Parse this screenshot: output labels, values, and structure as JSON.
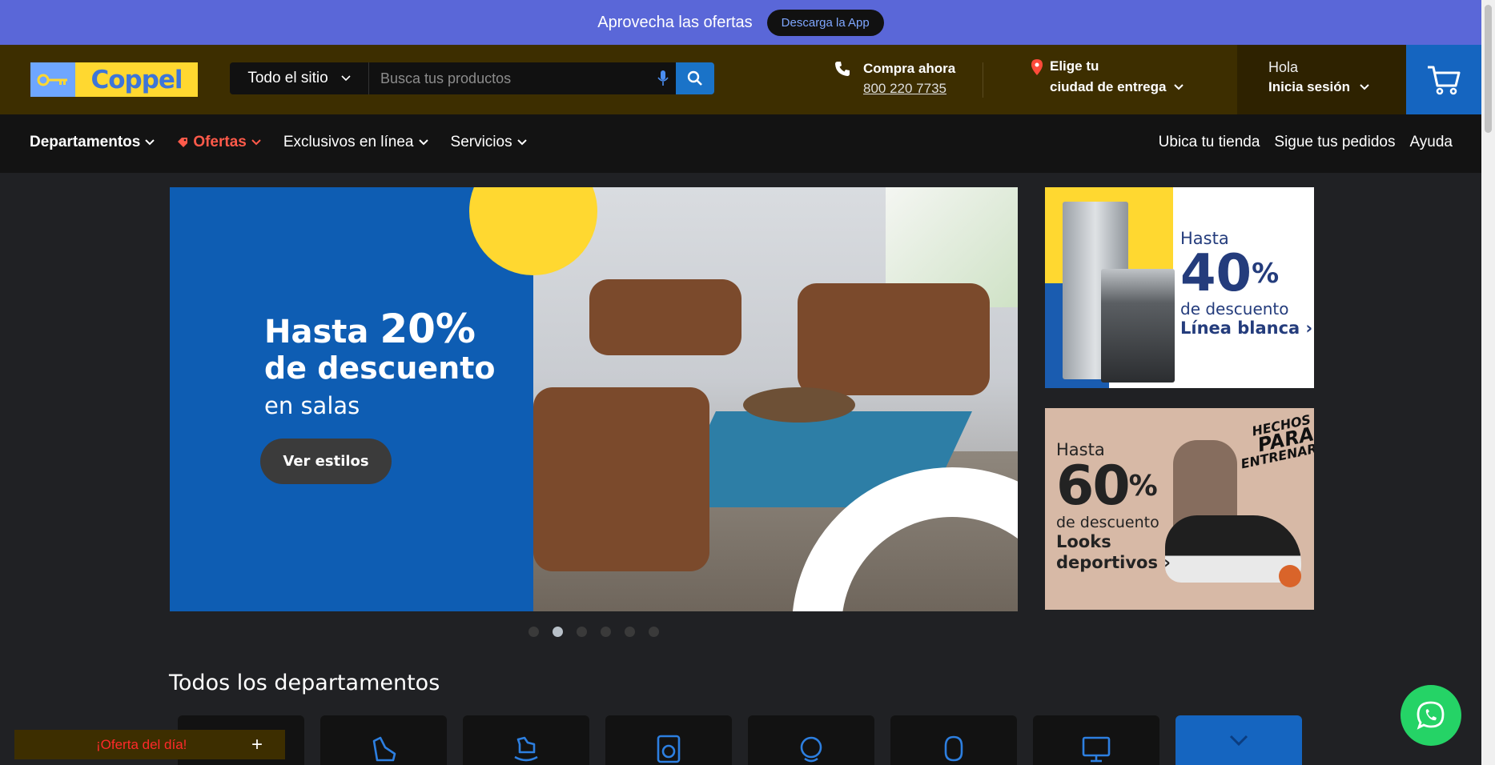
{
  "promo": {
    "text": "Aprovecha las ofertas",
    "button": "Descarga la App"
  },
  "header": {
    "logo": "Coppel",
    "search": {
      "category": "Todo el sitio",
      "placeholder": "Busca tus productos"
    },
    "phone": {
      "label": "Compra ahora",
      "number": "800 220 7735"
    },
    "city": {
      "line1": "Elige tu",
      "line2": "ciudad de entrega"
    },
    "account": {
      "greeting": "Hola",
      "login": "Inicia sesión"
    }
  },
  "nav": {
    "left": [
      {
        "label": "Departamentos"
      },
      {
        "label": "Ofertas"
      },
      {
        "label": "Exclusivos en línea"
      },
      {
        "label": "Servicios"
      }
    ],
    "right": [
      "Ubica tu tienda",
      "Sigue tus pedidos",
      "Ayuda"
    ]
  },
  "hero": {
    "line1_prefix": "Hasta",
    "line1_pct": "20%",
    "line2": "de descuento",
    "line3": "en salas",
    "button": "Ver estilos",
    "dots_total": 6,
    "dots_active": 2
  },
  "banner1": {
    "hasta": "Hasta",
    "pct": "40",
    "pct_sign": "%",
    "desc": "de descuento",
    "link": "Línea blanca ›"
  },
  "banner2": {
    "hasta": "Hasta",
    "pct": "60",
    "pct_sign": "%",
    "desc": "de descuento",
    "link1": "Looks",
    "link2": "deportivos ›",
    "tag1": "HECHOS",
    "tag2": "PARA",
    "tag3": "ENTRENAR"
  },
  "departments": {
    "title": "Todos los departamentos"
  },
  "deal": {
    "text": "¡Oferta del día!",
    "plus": "+"
  },
  "colors": {
    "promo": "#5a67d8",
    "header": "#3d2e00",
    "accent_blue": "#1565c0",
    "offer_red": "#ff5a4a",
    "whatsapp": "#25d366"
  }
}
